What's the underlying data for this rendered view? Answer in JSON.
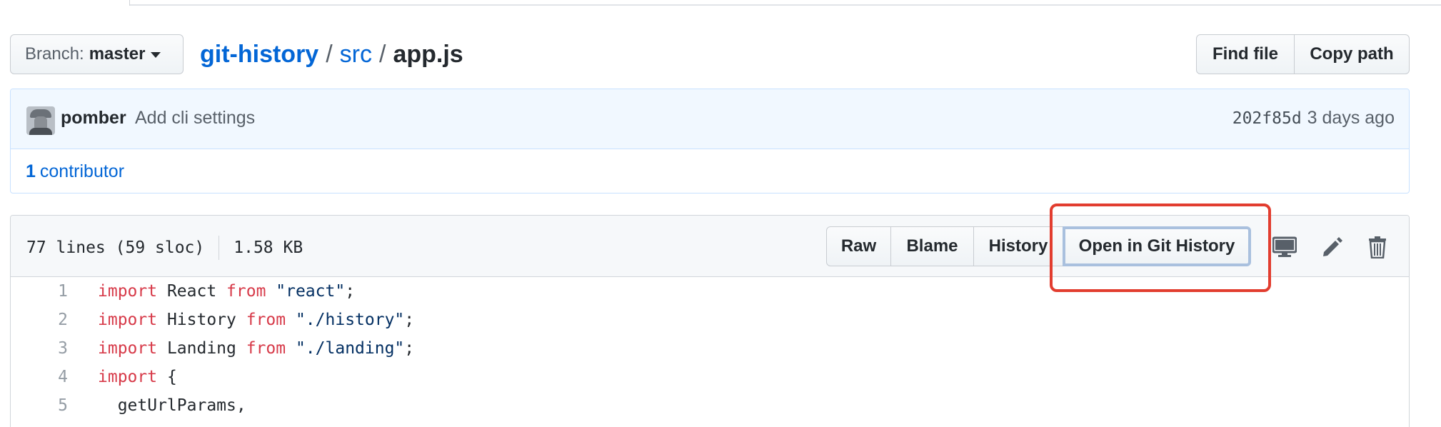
{
  "nav": {
    "branch_label": "Branch:",
    "branch_value": "master",
    "repo": "git-history",
    "separator": "/",
    "dir": "src",
    "file": "app.js",
    "find_file": "Find file",
    "copy_path": "Copy path"
  },
  "commit": {
    "author": "pomber",
    "message": "Add cli settings",
    "sha": "202f85d",
    "time": "3 days ago",
    "contributors_count": "1",
    "contributors_label": "contributor"
  },
  "file": {
    "lines_info": "77 lines (59 sloc)",
    "size": "1.58 KB",
    "actions": {
      "raw": "Raw",
      "blame": "Blame",
      "history": "History",
      "open_git_history": "Open in Git History"
    },
    "icons": [
      "desktop-icon",
      "pencil-icon",
      "trash-icon"
    ]
  },
  "code": {
    "lines": [
      {
        "num": "1",
        "kw1": "import",
        "mid": " React ",
        "kw2": "from",
        "str": " \"react\"",
        "end": ";"
      },
      {
        "num": "2",
        "kw1": "import",
        "mid": " History ",
        "kw2": "from",
        "str": " \"./history\"",
        "end": ";"
      },
      {
        "num": "3",
        "kw1": "import",
        "mid": " Landing ",
        "kw2": "from",
        "str": " \"./landing\"",
        "end": ";"
      },
      {
        "num": "4",
        "kw1": "import",
        "mid": " {",
        "kw2": "",
        "str": "",
        "end": ""
      },
      {
        "num": "5",
        "kw1": "",
        "mid": "  getUrlParams,",
        "kw2": "",
        "str": "",
        "end": ""
      }
    ]
  },
  "colors": {
    "link": "#0366d6",
    "keyword": "#d73a49",
    "string": "#032f62",
    "highlight": "#e23d2f"
  }
}
